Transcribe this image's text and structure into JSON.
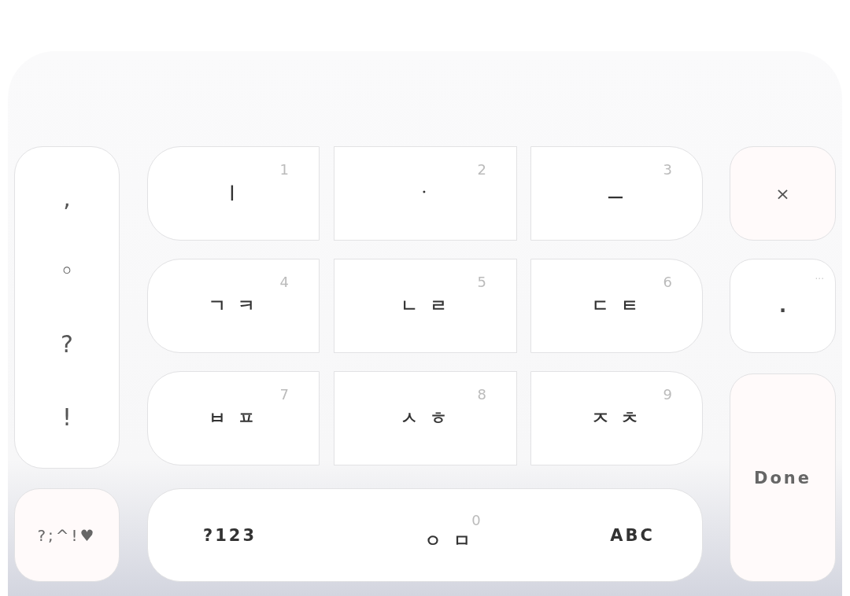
{
  "punctuation_keys": [
    ",",
    "◦",
    "?",
    "!"
  ],
  "letter_keys": [
    {
      "label": "ㅣ",
      "number": "1"
    },
    {
      "label": "ㆍ",
      "number": "2"
    },
    {
      "label": "ㅡ",
      "number": "3"
    },
    {
      "label": "ㄱ ㅋ",
      "number": "4"
    },
    {
      "label": "ㄴ ㄹ",
      "number": "5"
    },
    {
      "label": "ㄷ ㅌ",
      "number": "6"
    },
    {
      "label": "ㅂ ㅍ",
      "number": "7"
    },
    {
      "label": "ㅅ ㅎ",
      "number": "8"
    },
    {
      "label": "ㅈ ㅊ",
      "number": "9"
    }
  ],
  "symbols_key": {
    "label": "?;^!♥"
  },
  "bottom_bar": {
    "numbers_key": "?123",
    "center_key": {
      "label": "ㅇ ㅁ",
      "number": "0"
    },
    "letters_key": "ABC"
  },
  "delete_key": {
    "label": "×"
  },
  "period_key": {
    "label": ".",
    "hint": "···"
  },
  "done_key": {
    "label": "Done"
  }
}
